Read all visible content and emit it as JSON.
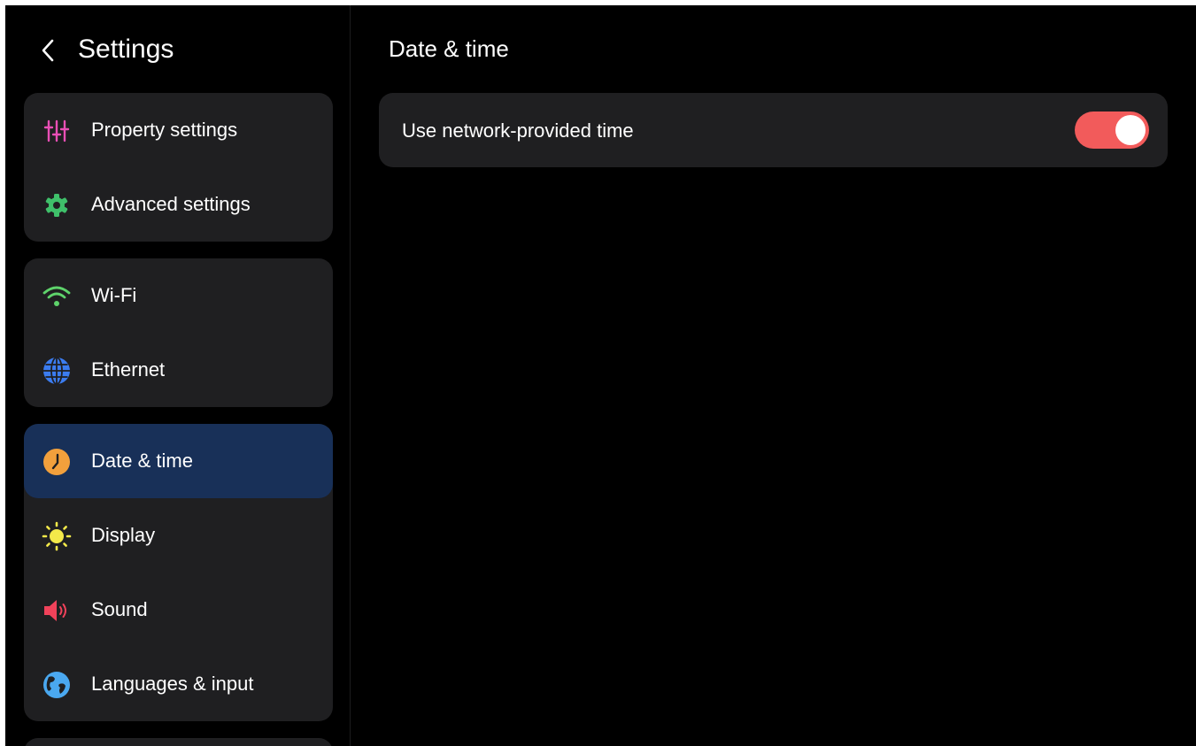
{
  "app": {
    "title": "Settings"
  },
  "sidebar": {
    "groups": [
      {
        "items": [
          {
            "label": "Property settings",
            "icon": "sliders-icon",
            "color": "#e94fb6"
          },
          {
            "label": "Advanced settings",
            "icon": "gear-icon",
            "color": "#3fc06a"
          }
        ]
      },
      {
        "items": [
          {
            "label": "Wi-Fi",
            "icon": "wifi-icon",
            "color": "#5ed36b"
          },
          {
            "label": "Ethernet",
            "icon": "globe-icon",
            "color": "#3b7cf0"
          }
        ]
      },
      {
        "items": [
          {
            "label": "Date & time",
            "icon": "clock-icon",
            "color": "#f2a03c",
            "selected": true
          },
          {
            "label": "Display",
            "icon": "sun-icon",
            "color": "#f3e94a"
          },
          {
            "label": "Sound",
            "icon": "speaker-icon",
            "color": "#f0425a"
          },
          {
            "label": "Languages & input",
            "icon": "earth-icon",
            "color": "#4aa8f0"
          }
        ]
      }
    ]
  },
  "main": {
    "title": "Date & time",
    "settings": [
      {
        "label": "Use network-provided time",
        "enabled": true
      }
    ]
  },
  "colors": {
    "background": "#000000",
    "card": "#1f1f21",
    "selected": "#183058",
    "toggle_on": "#f25b5b"
  }
}
